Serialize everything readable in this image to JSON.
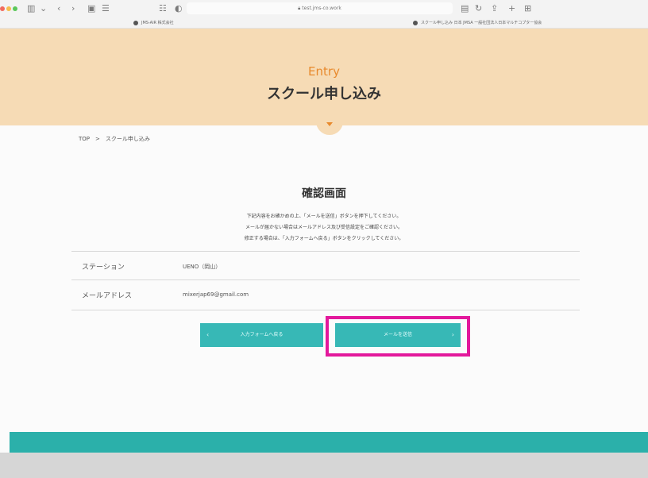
{
  "browser": {
    "url": "test.jms-co.work",
    "tab1": "JMS-AIR 株式会社",
    "tab2": "スクール申し込み 日本 JMSA 一般社団法人日本マルチコプター協会",
    "icons": [
      "sidebar-icon",
      "back-icon",
      "forward-icon",
      "extension-icon",
      "menu-icon",
      "shield-icon",
      "share-icon",
      "plus-icon",
      "tabs-icon"
    ]
  },
  "hero": {
    "en": "Entry",
    "ja": "スクール申し込み"
  },
  "breadcrumb": "TOP　>　スクール申し込み",
  "page": {
    "title": "確認画面",
    "messages": [
      "下記内容をお確かめの上、「メールを送信」ボタンを押下してください。",
      "メールが届かない場合はメールアドレス及び受信設定をご確認ください。",
      "修正する場合は、「入力フォームへ戻る」ボタンをクリックしてください。"
    ]
  },
  "form": {
    "rows": [
      {
        "label": "ステーション",
        "value": "UENO（岡山）"
      },
      {
        "label": "メールアドレス",
        "value": "mixerjap69@gmail.com"
      }
    ]
  },
  "buttons": {
    "back": "入力フォームへ戻る",
    "send": "メールを送信"
  },
  "colors": {
    "hero_bg": "#f6dbb5",
    "accent": "#e88a2d",
    "button": "#37b8b6",
    "highlight": "#e3199c",
    "footer": "#2bb0aa"
  }
}
